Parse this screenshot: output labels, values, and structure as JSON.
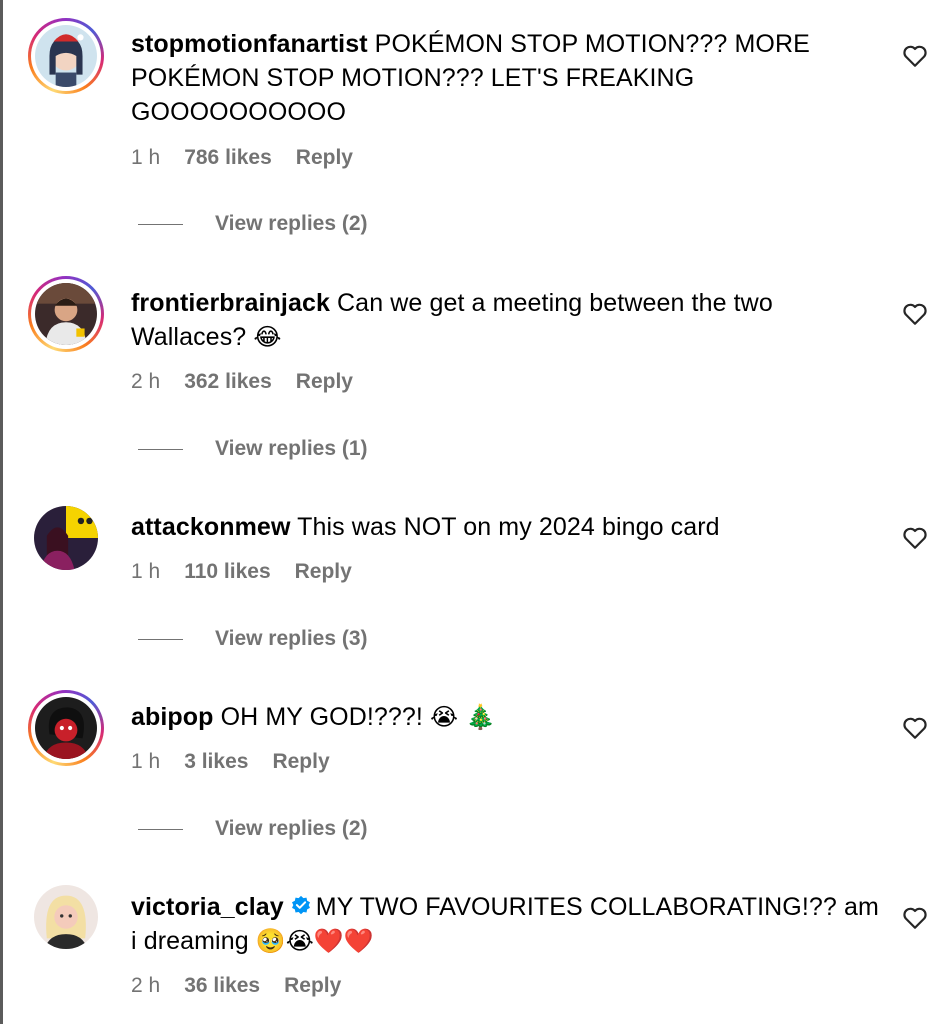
{
  "comments": [
    {
      "username": "stopmotionfanartist",
      "text": "POKÉMON STOP MOTION??? MORE POKÉMON STOP MOTION??? LET'S FREAKING GOOOOOOOOOO",
      "time": "1 h",
      "likes": "786 likes",
      "reply": "Reply",
      "view_replies": "View replies (2)"
    },
    {
      "username": "frontierbrainjack",
      "text": "Can we get a meeting between the two Wallaces?",
      "emoji": "😂",
      "time": "2 h",
      "likes": "362 likes",
      "reply": "Reply",
      "view_replies": "View replies (1)"
    },
    {
      "username": "attackonmew",
      "text": "This was NOT on my 2024 bingo card",
      "time": "1 h",
      "likes": "110 likes",
      "reply": "Reply",
      "view_replies": "View replies (3)"
    },
    {
      "username": "abipop",
      "text": "OH MY GOD!???!",
      "emoji": "😭 🎄",
      "time": "1 h",
      "likes": "3 likes",
      "reply": "Reply",
      "view_replies": "View replies (2)"
    },
    {
      "username": "victoria_clay",
      "verified": true,
      "text": "MY TWO FAVOURITES COLLABORATING!?? am i dreaming",
      "emoji": "🥹😭❤️❤️",
      "time": "2 h",
      "likes": "36 likes",
      "reply": "Reply"
    }
  ],
  "colors": {
    "meta_gray": "#737373",
    "verified_blue": "#0095f6"
  }
}
